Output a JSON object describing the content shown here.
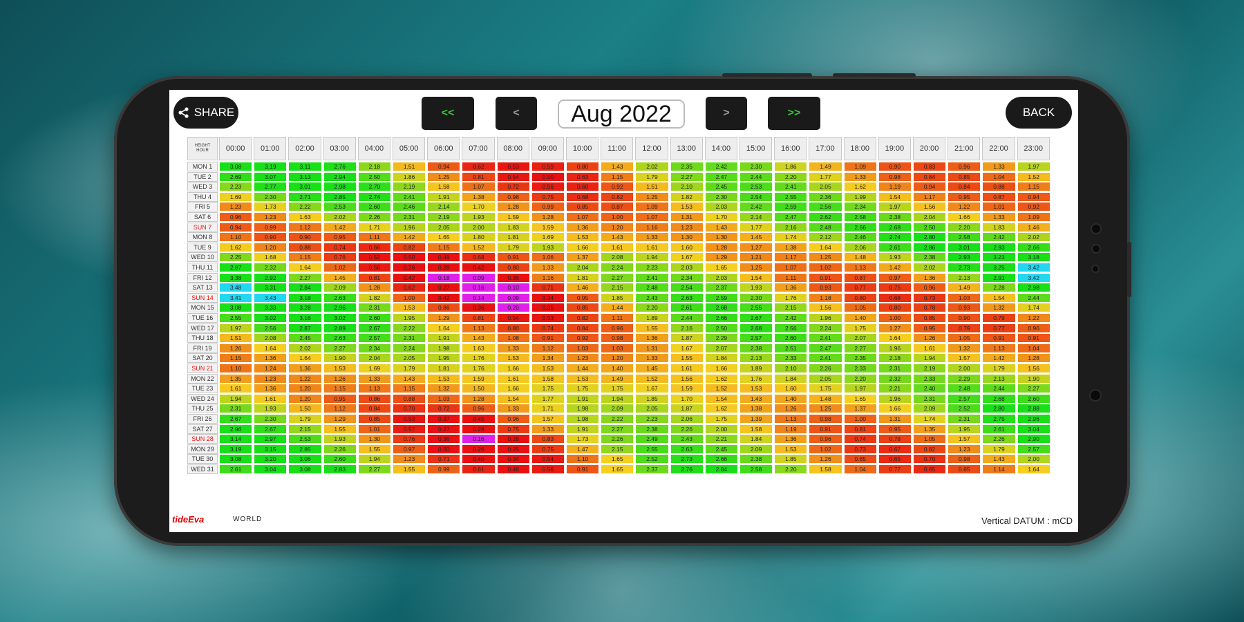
{
  "toolbar": {
    "share_label": "SHARE",
    "back_label": "BACK",
    "prev_year_label": "<<",
    "prev_month_label": "<",
    "next_month_label": ">",
    "next_year_label": ">>",
    "month_title": "Aug 2022"
  },
  "footer": {
    "logo": "tideEva",
    "world": "WORLD",
    "datum": "Vertical DATUM : mCD"
  },
  "table": {
    "corner_line1": "HEIGHT",
    "corner_line2": "HOUR",
    "hours": [
      "00:00",
      "01:00",
      "02:00",
      "03:00",
      "04:00",
      "05:00",
      "06:00",
      "07:00",
      "08:00",
      "09:00",
      "10:00",
      "11:00",
      "12:00",
      "13:00",
      "14:00",
      "15:00",
      "16:00",
      "17:00",
      "18:00",
      "19:00",
      "20:00",
      "21:00",
      "22:00",
      "23:00"
    ],
    "days": [
      {
        "label": "MON 1",
        "sun": false,
        "values": [
          3.08,
          3.19,
          3.11,
          2.76,
          2.18,
          1.51,
          0.94,
          0.62,
          0.53,
          0.59,
          0.8,
          1.43,
          2.02,
          2.35,
          2.42,
          2.3,
          1.86,
          1.49,
          1.09,
          0.9,
          0.83,
          0.96,
          1.33,
          1.97
        ]
      },
      {
        "label": "TUE 2",
        "sun": false,
        "values": [
          2.69,
          3.07,
          3.13,
          2.94,
          2.5,
          1.86,
          1.25,
          0.81,
          0.54,
          0.5,
          0.63,
          1.15,
          1.79,
          2.27,
          2.47,
          2.44,
          2.2,
          1.77,
          1.33,
          0.98,
          0.84,
          0.85,
          1.04,
          1.52
        ]
      },
      {
        "label": "WED 3",
        "sun": false,
        "values": [
          2.23,
          2.77,
          3.01,
          2.98,
          2.7,
          2.19,
          1.58,
          1.07,
          0.72,
          0.56,
          0.6,
          0.92,
          1.51,
          2.1,
          2.45,
          2.53,
          2.41,
          2.05,
          1.62,
          1.19,
          0.94,
          0.84,
          0.88,
          1.15
        ]
      },
      {
        "label": "THU 4",
        "sun": false,
        "values": [
          1.69,
          2.3,
          2.71,
          2.85,
          2.74,
          2.41,
          1.91,
          1.38,
          0.98,
          0.75,
          0.68,
          0.82,
          1.25,
          1.82,
          2.3,
          2.54,
          2.55,
          2.36,
          1.99,
          1.54,
          1.17,
          0.95,
          0.87,
          0.94
        ]
      },
      {
        "label": "FRI 5",
        "sun": false,
        "values": [
          1.23,
          1.73,
          2.22,
          2.53,
          2.6,
          2.46,
          2.14,
          1.7,
          1.28,
          0.99,
          0.85,
          0.87,
          1.09,
          1.53,
          2.03,
          2.42,
          2.59,
          2.56,
          2.34,
          1.97,
          1.56,
          1.22,
          1.01,
          0.92
        ]
      },
      {
        "label": "SAT 6",
        "sun": false,
        "values": [
          0.96,
          1.23,
          1.63,
          2.02,
          2.26,
          2.31,
          2.19,
          1.93,
          1.59,
          1.28,
          1.07,
          1.0,
          1.07,
          1.31,
          1.7,
          2.14,
          2.47,
          2.62,
          2.58,
          2.38,
          2.04,
          1.66,
          1.33,
          1.09
        ]
      },
      {
        "label": "SUN 7",
        "sun": true,
        "values": [
          0.94,
          0.99,
          1.12,
          1.42,
          1.71,
          1.96,
          2.05,
          2.0,
          1.83,
          1.59,
          1.36,
          1.2,
          1.16,
          1.23,
          1.43,
          1.77,
          2.16,
          2.48,
          2.66,
          2.68,
          2.5,
          2.2,
          1.83,
          1.46
        ]
      },
      {
        "label": "MON 8",
        "sun": false,
        "values": [
          1.1,
          0.9,
          0.9,
          0.95,
          1.11,
          1.42,
          1.65,
          1.8,
          1.81,
          1.69,
          1.53,
          1.43,
          1.33,
          1.3,
          1.3,
          1.45,
          1.74,
          2.12,
          2.46,
          2.74,
          2.8,
          2.58,
          2.42,
          2.02
        ]
      },
      {
        "label": "TUE 9",
        "sun": false,
        "values": [
          1.62,
          1.2,
          0.88,
          0.74,
          0.66,
          0.82,
          1.15,
          1.52,
          1.79,
          1.93,
          1.66,
          1.61,
          1.61,
          1.6,
          1.28,
          1.27,
          1.38,
          1.64,
          2.06,
          2.61,
          2.86,
          3.01,
          2.93,
          2.66
        ]
      },
      {
        "label": "WED 10",
        "sun": false,
        "values": [
          2.25,
          1.68,
          1.15,
          0.76,
          0.52,
          0.5,
          0.49,
          0.68,
          0.91,
          1.06,
          1.37,
          2.08,
          1.94,
          1.67,
          1.29,
          1.21,
          1.17,
          1.25,
          1.48,
          1.93,
          2.38,
          2.93,
          3.23,
          3.18
        ]
      },
      {
        "label": "THU 11",
        "sun": false,
        "values": [
          2.87,
          2.32,
          1.64,
          1.02,
          0.56,
          0.26,
          0.28,
          0.42,
          0.8,
          1.33,
          2.04,
          2.24,
          2.23,
          2.03,
          1.65,
          1.25,
          1.07,
          1.02,
          1.13,
          1.42,
          2.02,
          2.73,
          3.25,
          3.42
        ]
      },
      {
        "label": "FRI 12",
        "sun": false,
        "values": [
          3.38,
          2.92,
          2.27,
          1.45,
          0.81,
          0.42,
          0.18,
          0.09,
          0.36,
          1.16,
          1.81,
          2.27,
          2.41,
          2.34,
          2.03,
          1.54,
          1.11,
          0.91,
          0.87,
          0.97,
          1.36,
          2.13,
          2.91,
          3.42
        ]
      },
      {
        "label": "SAT 13",
        "sun": false,
        "values": [
          3.48,
          3.31,
          2.84,
          2.09,
          1.28,
          0.62,
          0.27,
          0.16,
          0.1,
          0.71,
          1.46,
          2.15,
          2.48,
          2.54,
          2.37,
          1.93,
          1.36,
          0.93,
          0.77,
          0.75,
          0.96,
          1.49,
          2.28,
          2.98
        ]
      },
      {
        "label": "SUN 14",
        "sun": true,
        "values": [
          3.41,
          3.43,
          3.18,
          2.63,
          1.82,
          1.0,
          0.42,
          0.14,
          0.09,
          0.34,
          0.95,
          1.85,
          2.43,
          2.63,
          2.59,
          2.3,
          1.76,
          1.18,
          0.8,
          0.68,
          0.73,
          1.03,
          1.54,
          2.44
        ]
      },
      {
        "label": "MON 15",
        "sun": false,
        "values": [
          3.08,
          3.33,
          3.28,
          2.96,
          2.31,
          1.53,
          0.86,
          0.36,
          0.2,
          0.35,
          0.85,
          1.44,
          2.2,
          2.61,
          2.68,
          2.55,
          2.15,
          1.56,
          1.05,
          0.8,
          0.78,
          0.93,
          1.32,
          1.74
        ]
      },
      {
        "label": "TUE 16",
        "sun": false,
        "values": [
          2.55,
          3.02,
          3.16,
          3.02,
          2.6,
          1.95,
          1.29,
          0.81,
          0.54,
          0.53,
          0.82,
          1.11,
          1.89,
          2.44,
          2.66,
          2.67,
          2.42,
          1.96,
          1.4,
          1.0,
          0.85,
          0.9,
          0.79,
          1.22
        ]
      },
      {
        "label": "WED 17",
        "sun": false,
        "values": [
          1.97,
          2.56,
          2.87,
          2.89,
          2.67,
          2.22,
          1.64,
          1.13,
          0.8,
          0.74,
          0.84,
          0.96,
          1.55,
          2.16,
          2.5,
          2.68,
          2.56,
          2.24,
          1.75,
          1.27,
          0.95,
          0.79,
          0.77,
          0.96
        ]
      },
      {
        "label": "THU 18",
        "sun": false,
        "values": [
          1.51,
          2.08,
          2.45,
          2.63,
          2.57,
          2.31,
          1.91,
          1.43,
          1.08,
          0.91,
          0.92,
          0.98,
          1.36,
          1.87,
          2.29,
          2.57,
          2.6,
          2.41,
          2.07,
          1.64,
          1.26,
          1.05,
          0.91,
          0.91
        ]
      },
      {
        "label": "FRI 19",
        "sun": false,
        "values": [
          1.26,
          1.64,
          2.02,
          2.27,
          2.34,
          2.24,
          1.98,
          1.63,
          1.33,
          1.12,
          1.03,
          1.03,
          1.31,
          1.67,
          2.07,
          2.38,
          2.51,
          2.47,
          2.27,
          1.96,
          1.61,
          1.32,
          1.13,
          1.04
        ]
      },
      {
        "label": "SAT 20",
        "sun": false,
        "values": [
          1.15,
          1.36,
          1.64,
          1.9,
          2.04,
          2.05,
          1.95,
          1.76,
          1.53,
          1.34,
          1.23,
          1.2,
          1.33,
          1.55,
          1.84,
          2.13,
          2.33,
          2.41,
          2.35,
          2.18,
          1.94,
          1.57,
          1.42,
          1.28
        ]
      },
      {
        "label": "SUN 21",
        "sun": true,
        "values": [
          1.1,
          1.24,
          1.36,
          1.53,
          1.69,
          1.79,
          1.81,
          1.76,
          1.66,
          1.53,
          1.44,
          1.4,
          1.45,
          1.61,
          1.66,
          1.89,
          2.1,
          2.26,
          2.33,
          2.31,
          2.19,
          2.0,
          1.79,
          1.56
        ]
      },
      {
        "label": "MON 22",
        "sun": false,
        "values": [
          1.35,
          1.23,
          1.22,
          1.26,
          1.33,
          1.43,
          1.53,
          1.59,
          1.61,
          1.58,
          1.53,
          1.49,
          1.52,
          1.56,
          1.62,
          1.76,
          1.84,
          2.05,
          2.2,
          2.32,
          2.33,
          2.29,
          2.13,
          1.9
        ]
      },
      {
        "label": "TUE 23",
        "sun": false,
        "values": [
          1.61,
          1.36,
          1.2,
          1.15,
          1.13,
          1.15,
          1.32,
          1.5,
          1.66,
          1.75,
          1.75,
          1.75,
          1.67,
          1.59,
          1.52,
          1.53,
          1.6,
          1.75,
          1.97,
          2.21,
          2.4,
          2.48,
          2.44,
          2.27
        ]
      },
      {
        "label": "WED 24",
        "sun": false,
        "values": [
          1.94,
          1.61,
          1.2,
          0.95,
          0.86,
          0.88,
          1.03,
          1.28,
          1.54,
          1.77,
          1.91,
          1.94,
          1.85,
          1.7,
          1.54,
          1.43,
          1.4,
          1.48,
          1.65,
          1.96,
          2.31,
          2.57,
          2.68,
          2.6
        ]
      },
      {
        "label": "THU 25",
        "sun": false,
        "values": [
          2.31,
          1.93,
          1.5,
          1.12,
          0.84,
          0.7,
          0.72,
          0.96,
          1.33,
          1.71,
          1.98,
          2.09,
          2.05,
          1.87,
          1.62,
          1.38,
          1.26,
          1.25,
          1.37,
          1.66,
          2.09,
          2.52,
          2.8,
          2.88
        ]
      },
      {
        "label": "FRI 26",
        "sun": false,
        "values": [
          2.67,
          2.3,
          1.79,
          1.29,
          0.85,
          0.53,
          0.37,
          0.45,
          0.96,
          1.57,
          1.98,
          2.22,
          2.23,
          2.06,
          1.75,
          1.39,
          1.13,
          0.98,
          1.0,
          1.31,
          1.74,
          2.31,
          2.75,
          2.96
        ]
      },
      {
        "label": "SAT 27",
        "sun": false,
        "values": [
          2.96,
          2.67,
          2.15,
          1.55,
          1.01,
          0.57,
          0.27,
          0.28,
          0.75,
          1.33,
          1.91,
          2.27,
          2.38,
          2.26,
          2.0,
          1.58,
          1.19,
          0.91,
          0.81,
          0.95,
          1.35,
          1.95,
          2.61,
          3.04
        ]
      },
      {
        "label": "SUN 28",
        "sun": true,
        "values": [
          3.14,
          2.97,
          2.53,
          1.93,
          1.3,
          0.76,
          0.36,
          0.16,
          0.28,
          0.83,
          1.73,
          2.26,
          2.49,
          2.43,
          2.21,
          1.84,
          1.36,
          0.96,
          0.74,
          0.78,
          1.05,
          1.57,
          2.26,
          2.9
        ]
      },
      {
        "label": "MON 29",
        "sun": false,
        "values": [
          3.19,
          3.15,
          2.85,
          2.26,
          1.55,
          0.97,
          0.5,
          0.26,
          0.25,
          0.75,
          1.47,
          2.15,
          2.55,
          2.63,
          2.45,
          2.09,
          1.53,
          1.02,
          0.73,
          0.67,
          0.82,
          1.23,
          1.79,
          2.57
        ]
      },
      {
        "label": "TUE 30",
        "sun": false,
        "values": [
          3.08,
          3.2,
          3.06,
          2.6,
          1.94,
          1.23,
          0.71,
          0.4,
          0.34,
          0.54,
          1.1,
          1.65,
          2.52,
          2.73,
          2.66,
          2.38,
          1.85,
          1.26,
          0.85,
          0.65,
          0.7,
          0.98,
          1.43,
          2.0
        ]
      },
      {
        "label": "WED 31",
        "sun": false,
        "values": [
          2.61,
          3.04,
          3.08,
          2.83,
          2.27,
          1.55,
          0.99,
          0.61,
          0.48,
          0.56,
          0.91,
          1.65,
          2.37,
          2.76,
          2.84,
          2.58,
          2.2,
          1.58,
          1.04,
          0.77,
          0.65,
          0.85,
          1.14,
          1.64
        ]
      }
    ]
  },
  "colors": {
    "low": "#e81010",
    "mid": "#f5d020",
    "high": "#18e018",
    "extreme_low": "#e020e8",
    "extreme_high": "#22d8f0"
  }
}
